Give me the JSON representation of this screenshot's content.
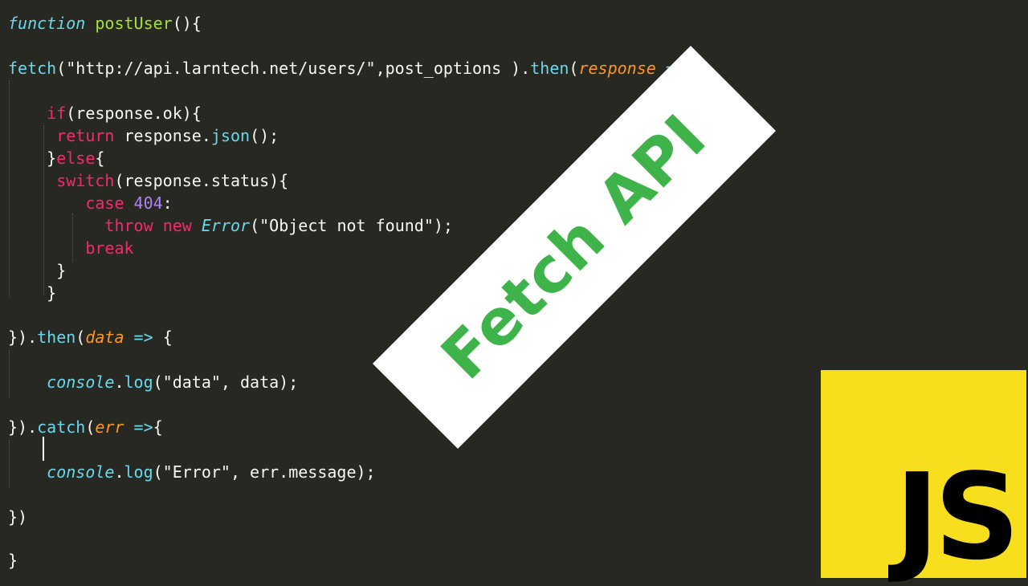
{
  "editor": {
    "lines": [
      {
        "tokens": [
          {
            "t": "function",
            "c": "fnkw"
          },
          {
            "t": " ",
            "c": "plain"
          },
          {
            "t": "postUser",
            "c": "fn"
          },
          {
            "t": "(){",
            "c": "plain"
          }
        ]
      },
      {
        "tokens": [
          {
            "t": "fetch",
            "c": "meth"
          },
          {
            "t": "(",
            "c": "plain"
          },
          {
            "t": "\"http://api.larntech.net/users/\"",
            "c": "plain"
          },
          {
            "t": ",post_options ).",
            "c": "plain"
          },
          {
            "t": "then",
            "c": "meth"
          },
          {
            "t": "(",
            "c": "plain"
          },
          {
            "t": "response",
            "c": "param"
          },
          {
            "t": " => ",
            "c": "op"
          },
          {
            "t": "{",
            "c": "plain"
          }
        ]
      },
      {
        "tokens": [
          {
            "t": "    ",
            "c": "plain"
          },
          {
            "t": "if",
            "c": "kw"
          },
          {
            "t": "(response.ok){",
            "c": "plain"
          }
        ]
      },
      {
        "tokens": [
          {
            "t": "     ",
            "c": "plain"
          },
          {
            "t": "return",
            "c": "kw"
          },
          {
            "t": " response.",
            "c": "plain"
          },
          {
            "t": "json",
            "c": "meth"
          },
          {
            "t": "();",
            "c": "plain"
          }
        ]
      },
      {
        "tokens": [
          {
            "t": "    }",
            "c": "plain"
          },
          {
            "t": "else",
            "c": "kw"
          },
          {
            "t": "{",
            "c": "plain"
          }
        ]
      },
      {
        "tokens": [
          {
            "t": "     ",
            "c": "plain"
          },
          {
            "t": "switch",
            "c": "kw"
          },
          {
            "t": "(response.status){",
            "c": "plain"
          }
        ]
      },
      {
        "tokens": [
          {
            "t": "        ",
            "c": "plain"
          },
          {
            "t": "case",
            "c": "kw"
          },
          {
            "t": " ",
            "c": "plain"
          },
          {
            "t": "404",
            "c": "num"
          },
          {
            "t": ":",
            "c": "plain"
          }
        ]
      },
      {
        "tokens": [
          {
            "t": "          ",
            "c": "plain"
          },
          {
            "t": "throw",
            "c": "kw"
          },
          {
            "t": " ",
            "c": "plain"
          },
          {
            "t": "new",
            "c": "kw"
          },
          {
            "t": " ",
            "c": "plain"
          },
          {
            "t": "Error",
            "c": "cls"
          },
          {
            "t": "(\"Object not found\");",
            "c": "plain"
          }
        ]
      },
      {
        "tokens": [
          {
            "t": "        ",
            "c": "plain"
          },
          {
            "t": "break",
            "c": "kw"
          }
        ]
      },
      {
        "tokens": [
          {
            "t": "     }",
            "c": "plain"
          }
        ]
      },
      {
        "tokens": [
          {
            "t": "    }",
            "c": "plain"
          }
        ]
      },
      {
        "tokens": [
          {
            "t": "}).",
            "c": "plain"
          },
          {
            "t": "then",
            "c": "meth"
          },
          {
            "t": "(",
            "c": "plain"
          },
          {
            "t": "data",
            "c": "param"
          },
          {
            "t": " => ",
            "c": "op"
          },
          {
            "t": "{",
            "c": "plain"
          }
        ]
      },
      {
        "tokens": [
          {
            "t": "    ",
            "c": "plain"
          },
          {
            "t": "console",
            "c": "cls"
          },
          {
            "t": ".",
            "c": "plain"
          },
          {
            "t": "log",
            "c": "meth"
          },
          {
            "t": "(\"data\", data);",
            "c": "plain"
          }
        ]
      },
      {
        "tokens": [
          {
            "t": "}).",
            "c": "plain"
          },
          {
            "t": "catch",
            "c": "meth"
          },
          {
            "t": "(",
            "c": "plain"
          },
          {
            "t": "err",
            "c": "param"
          },
          {
            "t": " =>",
            "c": "op"
          },
          {
            "t": "{",
            "c": "plain"
          }
        ]
      },
      {
        "tokens": [
          {
            "t": "    ",
            "c": "plain"
          },
          {
            "t": "console",
            "c": "cls"
          },
          {
            "t": ".",
            "c": "plain"
          },
          {
            "t": "log",
            "c": "meth"
          },
          {
            "t": "(\"Error\", err.message);",
            "c": "plain"
          }
        ]
      },
      {
        "tokens": [
          {
            "t": "})",
            "c": "plain"
          }
        ]
      },
      {
        "tokens": [
          {
            "t": "}",
            "c": "plain"
          }
        ]
      }
    ]
  },
  "banner": {
    "text": "Fetch API",
    "color": "#3db34a"
  },
  "logo": {
    "text": "JS",
    "background": "#f7df1e",
    "icon": "javascript-logo-icon"
  },
  "colors": {
    "background": "#272822",
    "keyword": "#f92672",
    "function_name": "#a6e22e",
    "number": "#ae81ff",
    "parameter": "#fd971f",
    "builtin": "#66d9ef"
  }
}
